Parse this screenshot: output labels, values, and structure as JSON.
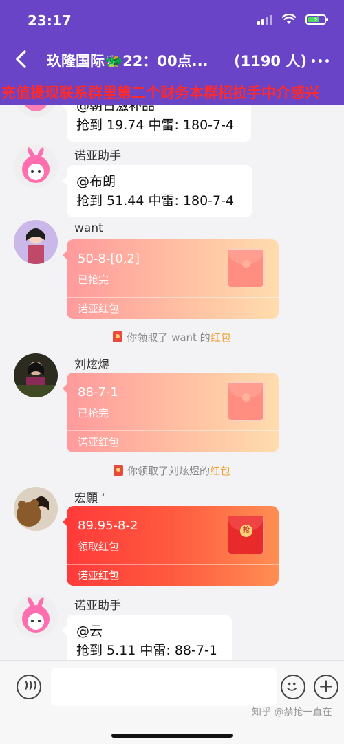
{
  "status_bar": {
    "time": "23:17"
  },
  "header": {
    "title": "玖隆国际🐲22：00点...",
    "member_count": "(1190 人)"
  },
  "marquee": "充值提现联系群里第二个财务本群招拉手中介感兴",
  "messages": {
    "m1": {
      "text1": "@朝日滋补品",
      "text2": "抢到 19.74  中雷: 180-7-4"
    },
    "m2": {
      "sender": "诺亚助手",
      "text1": "@布朗",
      "text2": "抢到 51.44  中雷: 180-7-4"
    },
    "m3": {
      "sender": "want",
      "title": "50-8-[0,2]",
      "status": "已抢完",
      "footer": "诺亚红包"
    },
    "s1": {
      "prefix": "你领取了 want 的",
      "highlight": "红包"
    },
    "m4": {
      "sender": "刘炫煜",
      "title": "88-7-1",
      "status": "已抢完",
      "footer": "诺亚红包"
    },
    "s2": {
      "prefix": "你领取了刘炫煜的",
      "highlight": "红包"
    },
    "m5": {
      "sender": "宏願 ‘",
      "title": "89.95-8-2",
      "status": "领取红包",
      "footer": "诺亚红包",
      "seal": "抢"
    },
    "m6": {
      "sender": "诺亚助手",
      "text1": "@云",
      "text2": "抢到 5.11  中雷: 88-7-1"
    }
  },
  "input": {
    "placeholder": ""
  },
  "watermark": "知乎 @禁抢一直在",
  "colors": {
    "header_bg": "#6a44c6",
    "marquee_text": "#ff2a2a",
    "highlight": "#f0a030"
  }
}
